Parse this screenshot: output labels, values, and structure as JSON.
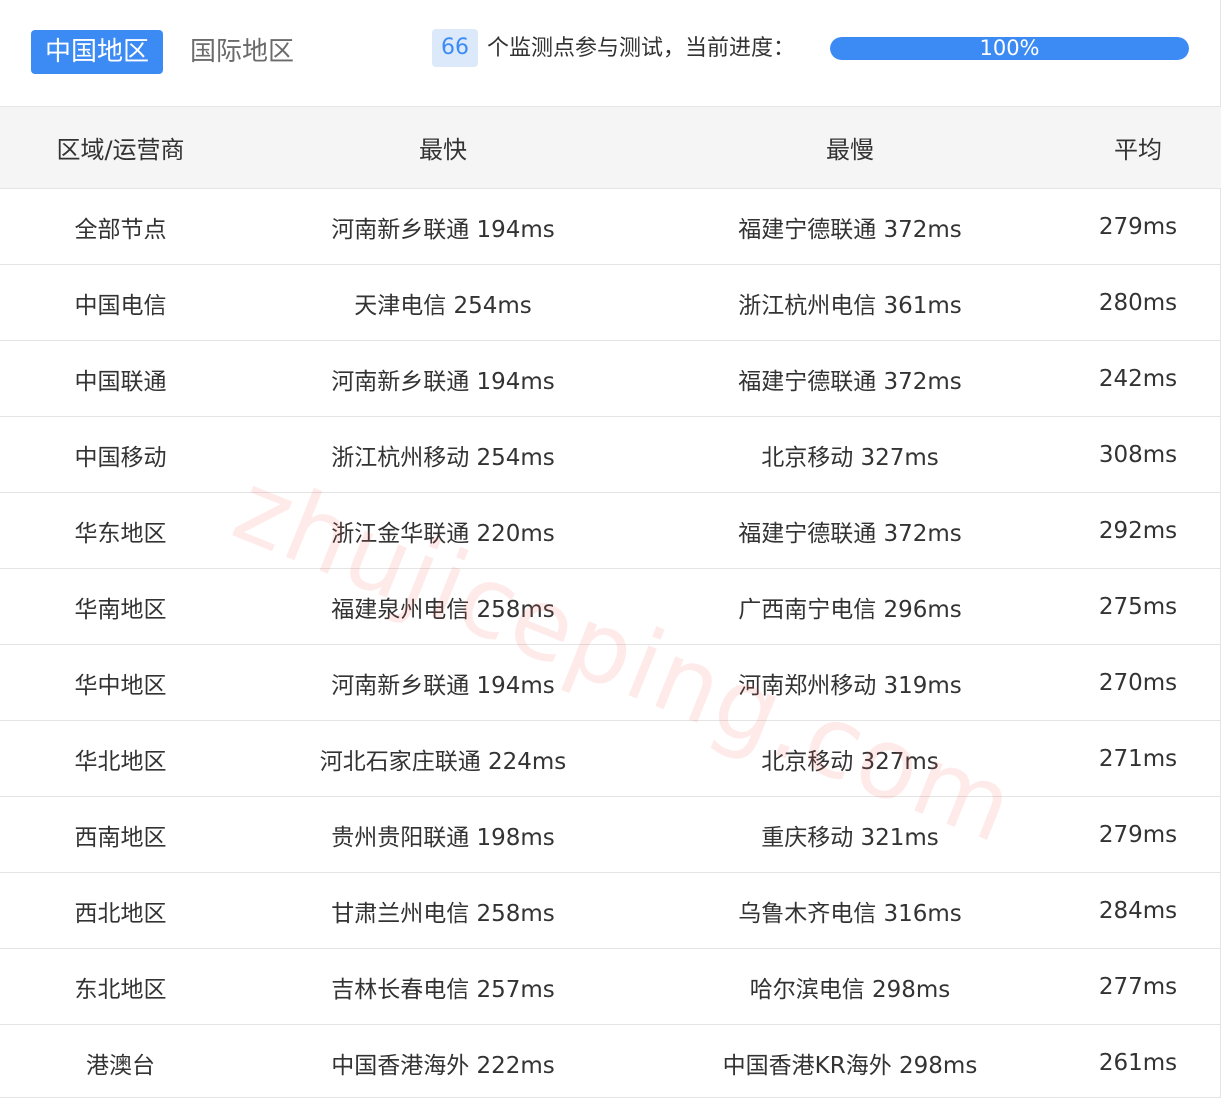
{
  "tabs": [
    {
      "label": "中国地区",
      "active": true
    },
    {
      "label": "国际地区",
      "active": false
    }
  ],
  "status": {
    "count": "66",
    "text": "个监测点参与测试，当前进度：",
    "progress_label": "100%",
    "progress_percent": 100
  },
  "table": {
    "headers": [
      "区域/运营商",
      "最快",
      "最慢",
      "平均"
    ],
    "rows": [
      [
        "全部节点",
        "河南新乡联通 194ms",
        "福建宁德联通 372ms",
        "279ms"
      ],
      [
        "中国电信",
        "天津电信 254ms",
        "浙江杭州电信 361ms",
        "280ms"
      ],
      [
        "中国联通",
        "河南新乡联通 194ms",
        "福建宁德联通 372ms",
        "242ms"
      ],
      [
        "中国移动",
        "浙江杭州移动 254ms",
        "北京移动 327ms",
        "308ms"
      ],
      [
        "华东地区",
        "浙江金华联通 220ms",
        "福建宁德联通 372ms",
        "292ms"
      ],
      [
        "华南地区",
        "福建泉州电信 258ms",
        "广西南宁电信 296ms",
        "275ms"
      ],
      [
        "华中地区",
        "河南新乡联通 194ms",
        "河南郑州移动 319ms",
        "270ms"
      ],
      [
        "华北地区",
        "河北石家庄联通 224ms",
        "北京移动 327ms",
        "271ms"
      ],
      [
        "西南地区",
        "贵州贵阳联通 198ms",
        "重庆移动 321ms",
        "279ms"
      ],
      [
        "西北地区",
        "甘肃兰州电信 258ms",
        "乌鲁木齐电信 316ms",
        "284ms"
      ],
      [
        "东北地区",
        "吉林长春电信 257ms",
        "哈尔滨电信 298ms",
        "277ms"
      ],
      [
        "港澳台",
        "中国香港海外 222ms",
        "中国香港KR海外 298ms",
        "261ms"
      ]
    ]
  },
  "watermark": {
    "text": "zhujiceping.com"
  },
  "colors": {
    "accent": "#3c8bf5",
    "badge_bg": "#dce9fb",
    "header_bg": "#f5f5f5",
    "watermark": "#ff5a5a"
  }
}
